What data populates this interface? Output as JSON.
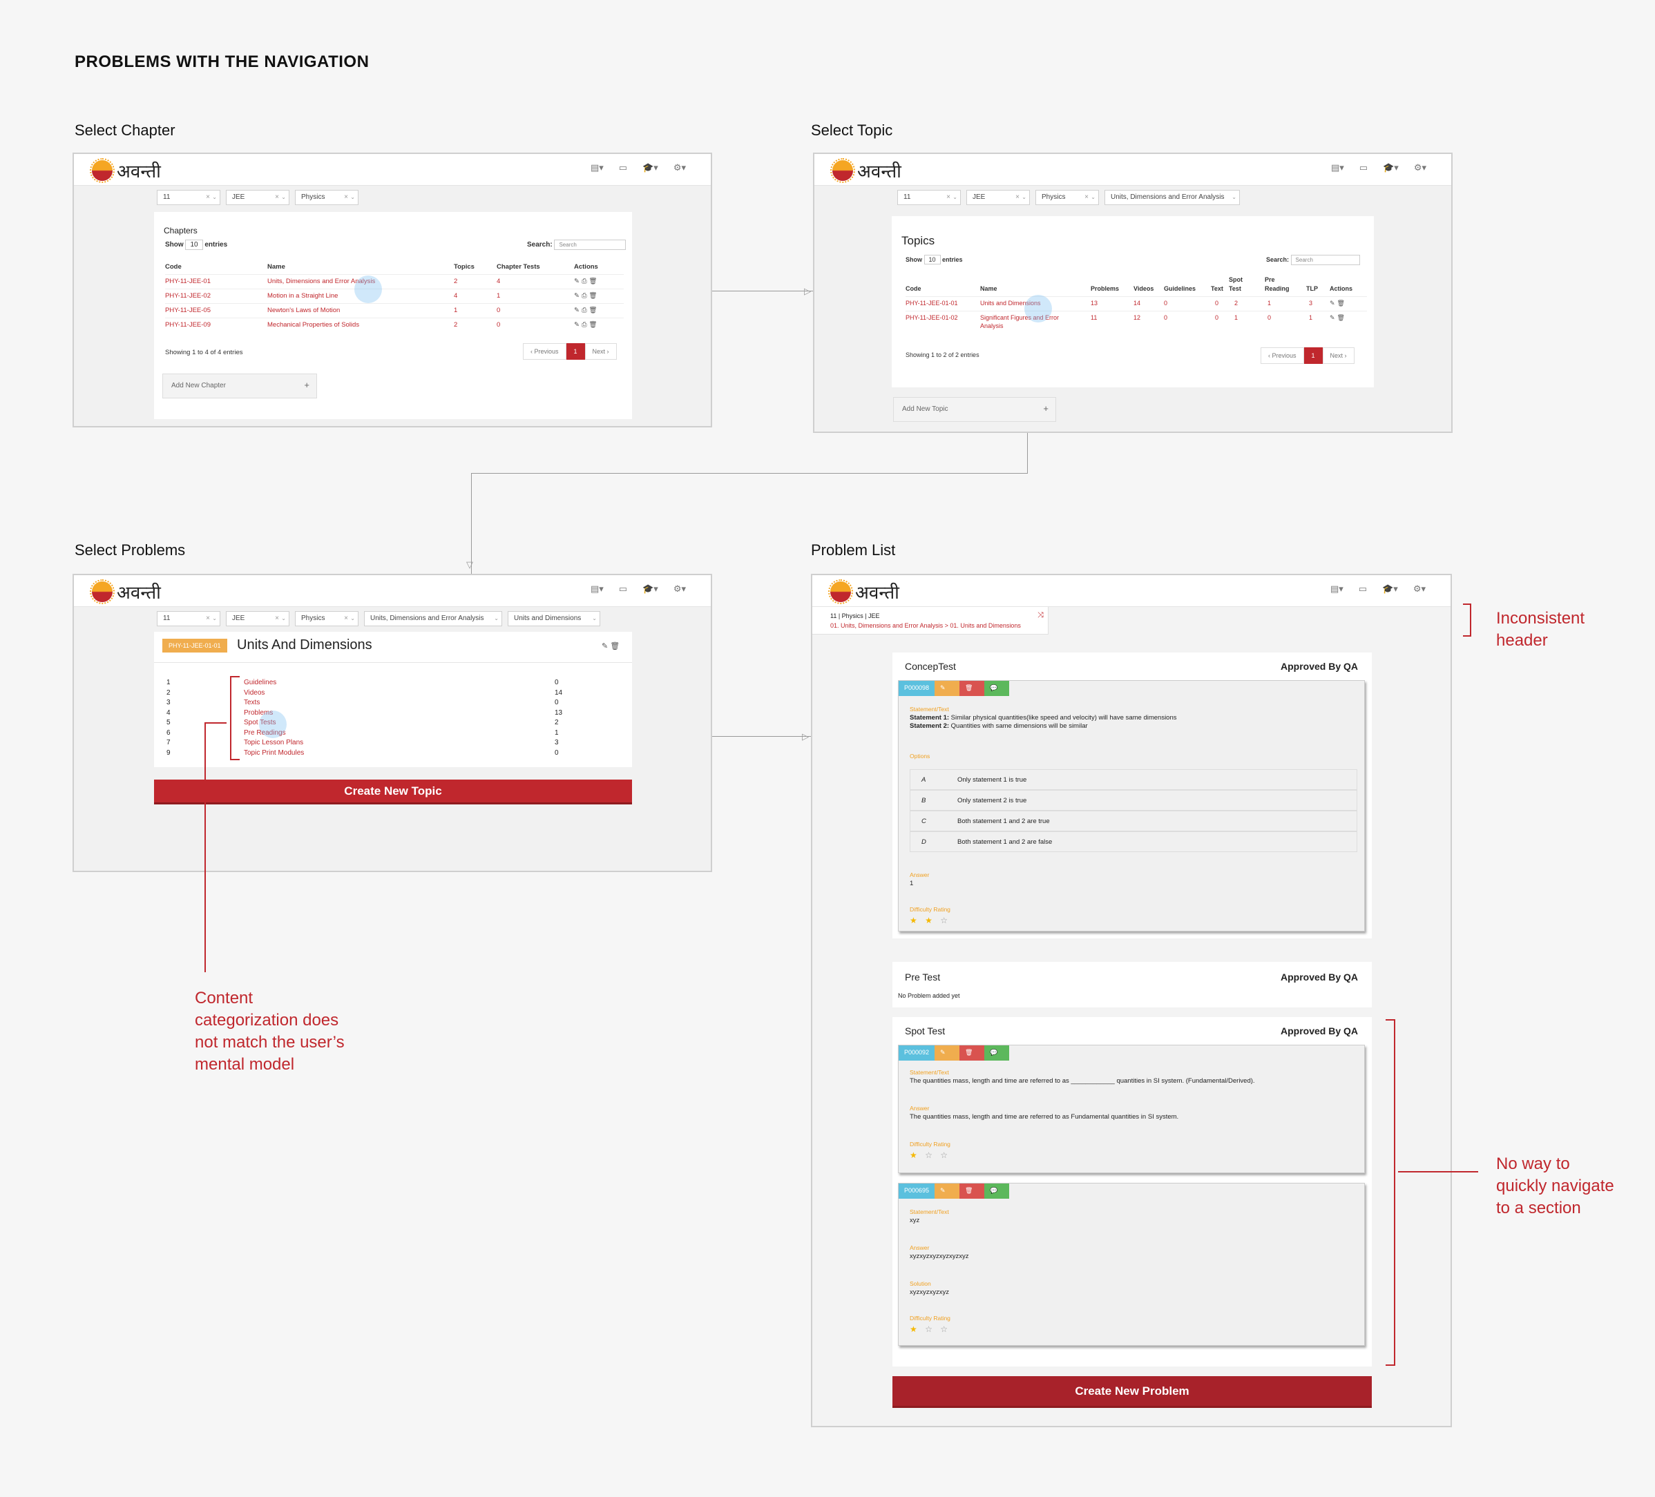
{
  "heading": "PROBLEMS WITH THE NAVIGATION",
  "colors": {
    "accent": "#c0272d",
    "orange": "#f0ad4e",
    "blue": "#5bc0de",
    "green": "#5cb85c"
  },
  "logo": "अवन्ती",
  "icons": [
    "file-icon",
    "folder-icon",
    "graduation-cap-icon",
    "gear-icon"
  ],
  "chapter": {
    "label": "Select Chapter",
    "filters": [
      "11",
      "JEE",
      "Physics"
    ],
    "title": "Chapters",
    "show": "Show",
    "entries_count": "10",
    "entries": "entries",
    "search_label": "Search:",
    "search_placeholder": "Search",
    "columns": [
      "Code",
      "Name",
      "Topics",
      "Chapter Tests",
      "Actions"
    ],
    "rows": [
      {
        "code": "PHY-11-JEE-01",
        "name": "Units, Dimensions and Error Analysis",
        "topics": "2",
        "tests": "4"
      },
      {
        "code": "PHY-11-JEE-02",
        "name": "Motion in a Straight Line",
        "topics": "4",
        "tests": "1"
      },
      {
        "code": "PHY-11-JEE-05",
        "name": "Newton's Laws of Motion",
        "topics": "1",
        "tests": "0"
      },
      {
        "code": "PHY-11-JEE-09",
        "name": "Mechanical Properties of Solids",
        "topics": "2",
        "tests": "0"
      }
    ],
    "showing": "Showing 1 to 4 of 4 entries",
    "prev": "‹ Previous",
    "page": "1",
    "next": "Next ›",
    "add": "Add New Chapter",
    "plus": "+"
  },
  "topic": {
    "label": "Select Topic",
    "filters": [
      "11",
      "JEE",
      "Physics",
      "Units, Dimensions and Error Analysis"
    ],
    "title": "Topics",
    "show": "Show",
    "entries_count": "10",
    "entries": "entries",
    "search_label": "Search:",
    "search_placeholder": "Search",
    "columns": [
      "Code",
      "Name",
      "Problems",
      "Videos",
      "Guidelines",
      "Text",
      "Spot Test",
      "Pre Reading",
      "TLP",
      "Actions"
    ],
    "rows": [
      {
        "code": "PHY-11-JEE-01-01",
        "name": "Units and Dimensions",
        "name2": "",
        "problems": "13",
        "videos": "14",
        "guidelines": "0",
        "text": "0",
        "spot": "2",
        "pre": "1",
        "tlp": "3"
      },
      {
        "code": "PHY-11-JEE-01-02",
        "name": "Significant Figures and Error",
        "name2": "Analysis",
        "problems": "11",
        "videos": "12",
        "guidelines": "0",
        "text": "0",
        "spot": "1",
        "pre": "0",
        "tlp": "1"
      }
    ],
    "showing": "Showing 1 to 2 of 2 entries",
    "prev": "‹ Previous",
    "page": "1",
    "next": "Next ›",
    "add": "Add New Topic",
    "plus": "+"
  },
  "problems": {
    "label": "Select Problems",
    "filters": [
      "11",
      "JEE",
      "Physics",
      "Units, Dimensions and Error Analysis",
      "Units and Dimensions"
    ],
    "badge": "PHY-11-JEE-01-01",
    "title": "Units And Dimensions",
    "items": [
      {
        "n": "1",
        "name": "Guidelines",
        "count": "0"
      },
      {
        "n": "2",
        "name": "Videos",
        "count": "14"
      },
      {
        "n": "3",
        "name": "Texts",
        "count": "0"
      },
      {
        "n": "4",
        "name": "Problems",
        "count": "13"
      },
      {
        "n": "5",
        "name": "Spot Tests",
        "count": "2"
      },
      {
        "n": "6",
        "name": "Pre Readings",
        "count": "1"
      },
      {
        "n": "7",
        "name": "Topic Lesson Plans",
        "count": "3"
      },
      {
        "n": "9",
        "name": "Topic Print Modules",
        "count": "0"
      }
    ],
    "create": "Create New Topic"
  },
  "list": {
    "label": "Problem List",
    "breadcrumb1": "11 | Physics | JEE",
    "breadcrumb2": "01. Units, Dimensions and Error Analysis > 01. Units and Dimensions",
    "approved": "Approved By QA",
    "concep": {
      "title": "ConcepTest",
      "id": "P000098",
      "statement_label": "Statement/Text",
      "s1b": "Statement 1:",
      "s1": " Similar physical quantities(like speed and velocity) will have same dimensions",
      "s2b": "Statement 2:",
      "s2": " Quantities with same dimensions will be similar",
      "options_label": "Options",
      "options": [
        {
          "k": "A",
          "v": "Only statement 1 is true"
        },
        {
          "k": "B",
          "v": "Only statement 2 is true"
        },
        {
          "k": "C",
          "v": "Both statement 1 and 2 are true"
        },
        {
          "k": "D",
          "v": "Both statement 1 and 2 are false"
        }
      ],
      "answer_label": "Answer",
      "answer": "1",
      "difficulty_label": "Difficulty Rating",
      "stars_filled": "★ ★",
      "stars_empty": "☆",
      "rating": 2
    },
    "pretest": {
      "title": "Pre Test",
      "empty": "No Problem added yet"
    },
    "spot": {
      "title": "Spot Test",
      "q1": {
        "id": "P000092",
        "statement_label": "Statement/Text",
        "statement": "The quantities mass, length and time are referred to as ____________ quantities in SI system. (Fundamental/Derived).",
        "answer_label": "Answer",
        "answer": "The quantities mass, length and time are referred to as Fundamental quantities in SI system.",
        "difficulty_label": "Difficulty Rating",
        "stars_filled": "★",
        "stars_empty": "☆ ☆",
        "rating": 1
      },
      "q2": {
        "id": "P000695",
        "statement_label": "Statement/Text",
        "statement": "xyz",
        "answer_label": "Answer",
        "answer": "xyzxyzxyzxyzxyzxyz",
        "solution_label": "Solution",
        "solution": "xyzxyzxyzxyz",
        "difficulty_label": "Difficulty Rating",
        "stars_filled": "★",
        "stars_empty": "☆ ☆",
        "rating": 1
      }
    },
    "create": "Create New Problem"
  },
  "annotations": {
    "header": [
      "Inconsistent",
      "header"
    ],
    "content": [
      "Content",
      "categorization does",
      "not match the user’s",
      "mental model"
    ],
    "navigate": [
      "No way to",
      "quickly navigate",
      "to a section"
    ]
  }
}
